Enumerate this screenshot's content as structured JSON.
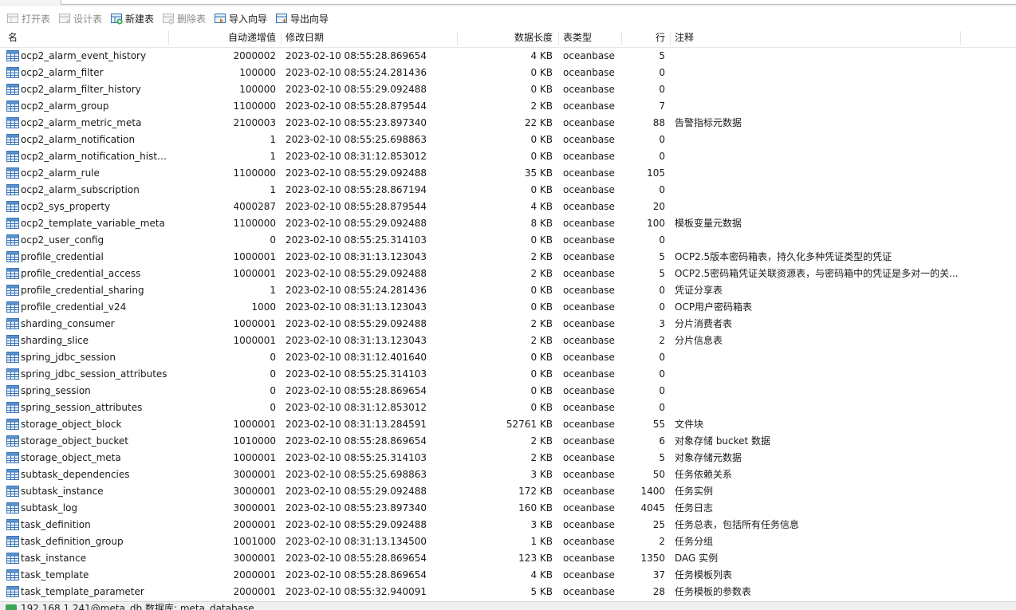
{
  "toolbar": {
    "open_table": "打开表",
    "design_table": "设计表",
    "new_table": "新建表",
    "delete_table": "删除表",
    "import_wizard": "导入向导",
    "export_wizard": "导出向导"
  },
  "columns": {
    "name": "名",
    "auto_increment": "自动递增值",
    "modified": "修改日期",
    "data_length": "数据长度",
    "table_type": "表类型",
    "rows": "行",
    "comment": "注释"
  },
  "tables": [
    {
      "name": "ocp2_alarm_event_history",
      "auto": "2000002",
      "date": "2023-02-10 08:55:28.869654",
      "len": "4 KB",
      "type": "oceanbase",
      "rows": "5",
      "note": ""
    },
    {
      "name": "ocp2_alarm_filter",
      "auto": "100000",
      "date": "2023-02-10 08:55:24.281436",
      "len": "0 KB",
      "type": "oceanbase",
      "rows": "0",
      "note": ""
    },
    {
      "name": "ocp2_alarm_filter_history",
      "auto": "100000",
      "date": "2023-02-10 08:55:29.092488",
      "len": "0 KB",
      "type": "oceanbase",
      "rows": "0",
      "note": ""
    },
    {
      "name": "ocp2_alarm_group",
      "auto": "1100000",
      "date": "2023-02-10 08:55:28.879544",
      "len": "2 KB",
      "type": "oceanbase",
      "rows": "7",
      "note": ""
    },
    {
      "name": "ocp2_alarm_metric_meta",
      "auto": "2100003",
      "date": "2023-02-10 08:55:23.897340",
      "len": "22 KB",
      "type": "oceanbase",
      "rows": "88",
      "note": "告警指标元数据"
    },
    {
      "name": "ocp2_alarm_notification",
      "auto": "1",
      "date": "2023-02-10 08:55:25.698863",
      "len": "0 KB",
      "type": "oceanbase",
      "rows": "0",
      "note": ""
    },
    {
      "name": "ocp2_alarm_notification_history",
      "auto": "1",
      "date": "2023-02-10 08:31:12.853012",
      "len": "0 KB",
      "type": "oceanbase",
      "rows": "0",
      "note": ""
    },
    {
      "name": "ocp2_alarm_rule",
      "auto": "1100000",
      "date": "2023-02-10 08:55:29.092488",
      "len": "35 KB",
      "type": "oceanbase",
      "rows": "105",
      "note": ""
    },
    {
      "name": "ocp2_alarm_subscription",
      "auto": "1",
      "date": "2023-02-10 08:55:28.867194",
      "len": "0 KB",
      "type": "oceanbase",
      "rows": "0",
      "note": ""
    },
    {
      "name": "ocp2_sys_property",
      "auto": "4000287",
      "date": "2023-02-10 08:55:28.879544",
      "len": "4 KB",
      "type": "oceanbase",
      "rows": "20",
      "note": ""
    },
    {
      "name": "ocp2_template_variable_meta",
      "auto": "1100000",
      "date": "2023-02-10 08:55:29.092488",
      "len": "8 KB",
      "type": "oceanbase",
      "rows": "100",
      "note": "模板变量元数据"
    },
    {
      "name": "ocp2_user_config",
      "auto": "0",
      "date": "2023-02-10 08:55:25.314103",
      "len": "0 KB",
      "type": "oceanbase",
      "rows": "0",
      "note": ""
    },
    {
      "name": "profile_credential",
      "auto": "1000001",
      "date": "2023-02-10 08:31:13.123043",
      "len": "2 KB",
      "type": "oceanbase",
      "rows": "5",
      "note": "OCP2.5版本密码箱表，持久化多种凭证类型的凭证"
    },
    {
      "name": "profile_credential_access",
      "auto": "1000001",
      "date": "2023-02-10 08:55:29.092488",
      "len": "2 KB",
      "type": "oceanbase",
      "rows": "5",
      "note": "OCP2.5密码箱凭证关联资源表，与密码箱中的凭证是多对一的关..."
    },
    {
      "name": "profile_credential_sharing",
      "auto": "1",
      "date": "2023-02-10 08:55:24.281436",
      "len": "0 KB",
      "type": "oceanbase",
      "rows": "0",
      "note": "凭证分享表"
    },
    {
      "name": "profile_credential_v24",
      "auto": "1000",
      "date": "2023-02-10 08:31:13.123043",
      "len": "0 KB",
      "type": "oceanbase",
      "rows": "0",
      "note": "OCP用户密码箱表"
    },
    {
      "name": "sharding_consumer",
      "auto": "1000001",
      "date": "2023-02-10 08:55:29.092488",
      "len": "2 KB",
      "type": "oceanbase",
      "rows": "3",
      "note": "分片消费者表"
    },
    {
      "name": "sharding_slice",
      "auto": "1000001",
      "date": "2023-02-10 08:31:13.123043",
      "len": "2 KB",
      "type": "oceanbase",
      "rows": "2",
      "note": "分片信息表"
    },
    {
      "name": "spring_jdbc_session",
      "auto": "0",
      "date": "2023-02-10 08:31:12.401640",
      "len": "0 KB",
      "type": "oceanbase",
      "rows": "0",
      "note": ""
    },
    {
      "name": "spring_jdbc_session_attributes",
      "auto": "0",
      "date": "2023-02-10 08:55:25.314103",
      "len": "0 KB",
      "type": "oceanbase",
      "rows": "0",
      "note": ""
    },
    {
      "name": "spring_session",
      "auto": "0",
      "date": "2023-02-10 08:55:28.869654",
      "len": "0 KB",
      "type": "oceanbase",
      "rows": "0",
      "note": ""
    },
    {
      "name": "spring_session_attributes",
      "auto": "0",
      "date": "2023-02-10 08:31:12.853012",
      "len": "0 KB",
      "type": "oceanbase",
      "rows": "0",
      "note": ""
    },
    {
      "name": "storage_object_block",
      "auto": "1000001",
      "date": "2023-02-10 08:31:13.284591",
      "len": "52761 KB",
      "type": "oceanbase",
      "rows": "55",
      "note": "文件块"
    },
    {
      "name": "storage_object_bucket",
      "auto": "1010000",
      "date": "2023-02-10 08:55:28.869654",
      "len": "2 KB",
      "type": "oceanbase",
      "rows": "6",
      "note": "对象存储 bucket 数据"
    },
    {
      "name": "storage_object_meta",
      "auto": "1000001",
      "date": "2023-02-10 08:55:25.314103",
      "len": "2 KB",
      "type": "oceanbase",
      "rows": "5",
      "note": "对象存储元数据"
    },
    {
      "name": "subtask_dependencies",
      "auto": "3000001",
      "date": "2023-02-10 08:55:25.698863",
      "len": "3 KB",
      "type": "oceanbase",
      "rows": "50",
      "note": "任务依赖关系"
    },
    {
      "name": "subtask_instance",
      "auto": "3000001",
      "date": "2023-02-10 08:55:29.092488",
      "len": "172 KB",
      "type": "oceanbase",
      "rows": "1400",
      "note": "任务实例"
    },
    {
      "name": "subtask_log",
      "auto": "3000001",
      "date": "2023-02-10 08:55:23.897340",
      "len": "160 KB",
      "type": "oceanbase",
      "rows": "4045",
      "note": "任务日志"
    },
    {
      "name": "task_definition",
      "auto": "2000001",
      "date": "2023-02-10 08:55:29.092488",
      "len": "3 KB",
      "type": "oceanbase",
      "rows": "25",
      "note": "任务总表，包括所有任务信息"
    },
    {
      "name": "task_definition_group",
      "auto": "1001000",
      "date": "2023-02-10 08:31:13.134500",
      "len": "1 KB",
      "type": "oceanbase",
      "rows": "2",
      "note": "任务分组"
    },
    {
      "name": "task_instance",
      "auto": "3000001",
      "date": "2023-02-10 08:55:28.869654",
      "len": "123 KB",
      "type": "oceanbase",
      "rows": "1350",
      "note": "DAG 实例"
    },
    {
      "name": "task_template",
      "auto": "2000001",
      "date": "2023-02-10 08:55:28.869654",
      "len": "4 KB",
      "type": "oceanbase",
      "rows": "37",
      "note": "任务模板列表"
    },
    {
      "name": "task_template_parameter",
      "auto": "2000001",
      "date": "2023-02-10 08:55:32.940091",
      "len": "5 KB",
      "type": "oceanbase",
      "rows": "28",
      "note": "任务模板的参数表"
    }
  ],
  "status": {
    "text": "192.168.1.241@meta_db    数据库: meta_database"
  }
}
